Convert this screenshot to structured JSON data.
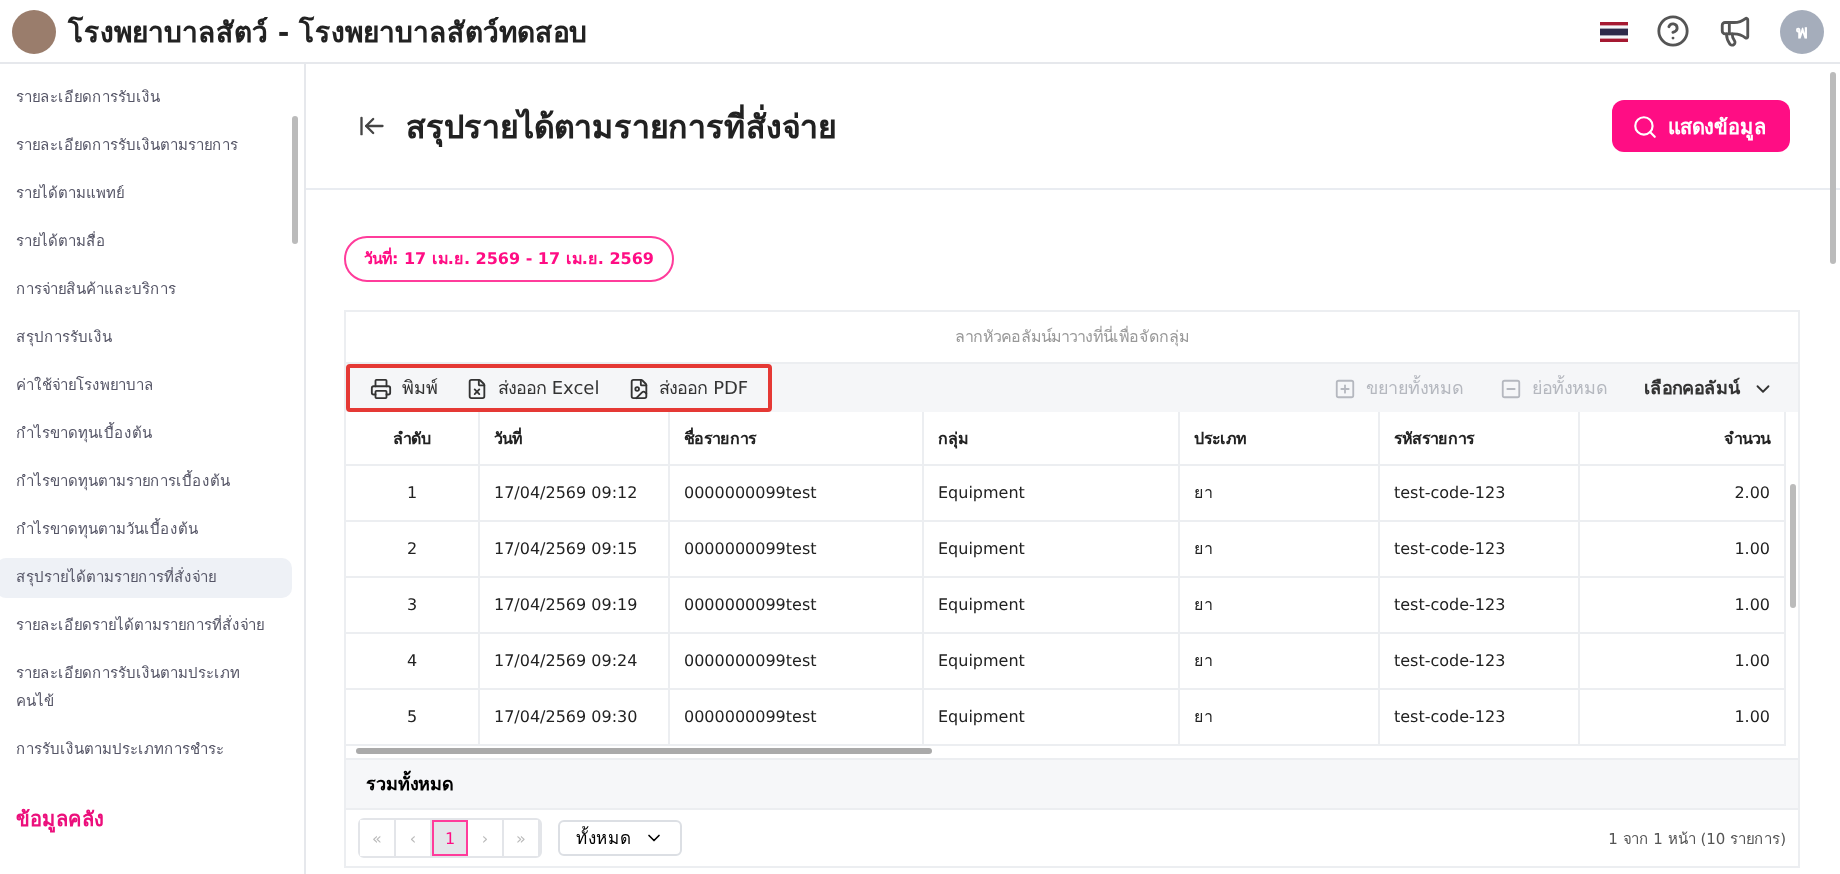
{
  "header": {
    "title": "โรงพยาบาลสัตว์ - โรงพยาบาลสัตว์ทดสอบ",
    "avatar": "พ"
  },
  "sidebar": {
    "items": [
      {
        "label": "รายละเอียดการรับเงิน",
        "selected": false
      },
      {
        "label": "รายละเอียดการรับเงินตามรายการ",
        "selected": false
      },
      {
        "label": "รายได้ตามแพทย์",
        "selected": false
      },
      {
        "label": "รายได้ตามสื่อ",
        "selected": false
      },
      {
        "label": "การจ่ายสินค้าและบริการ",
        "selected": false
      },
      {
        "label": "สรุปการรับเงิน",
        "selected": false
      },
      {
        "label": "ค่าใช้จ่ายโรงพยาบาล",
        "selected": false
      },
      {
        "label": "กำไรขาดทุนเบื้องต้น",
        "selected": false
      },
      {
        "label": "กำไรขาดทุนตามรายการเบื้องต้น",
        "selected": false
      },
      {
        "label": "กำไรขาดทุนตามวันเบื้องต้น",
        "selected": false
      },
      {
        "label": "สรุปรายได้ตามรายการที่สั่งจ่าย",
        "selected": true
      },
      {
        "label": "รายละเอียดรายได้ตามรายการที่สั่งจ่าย",
        "selected": false
      },
      {
        "label": "รายละเอียดการรับเงินตามประเภทคนไข้",
        "selected": false
      },
      {
        "label": "การรับเงินตามประเภทการชำระ",
        "selected": false
      }
    ],
    "section": "ข้อมูลคลัง"
  },
  "page": {
    "title": "สรุปรายได้ตามรายการที่สั่งจ่าย",
    "show_button": "แสดงข้อมูล",
    "date_range": "วันที่: 17 เม.ย. 2569 - 17 เม.ย. 2569"
  },
  "grid": {
    "group_hint": "ลากหัวคอลัมน์มาวางที่นี่เพื่อจัดกลุ่ม",
    "toolbar": [
      {
        "kind": "print",
        "label": "พิมพ์",
        "disabled": false
      },
      {
        "kind": "excel",
        "label": "ส่งออก Excel",
        "disabled": false
      },
      {
        "kind": "pdf",
        "label": "ส่งออก PDF",
        "disabled": false
      }
    ],
    "toolbar_right": [
      {
        "kind": "expand",
        "label": "ขยายทั้งหมด",
        "disabled": true
      },
      {
        "kind": "collapse",
        "label": "ย่อทั้งหมด",
        "disabled": true
      }
    ],
    "column_chooser": "เลือกคอลัมน์",
    "columns": [
      "ลำดับ",
      "วันที่",
      "ชื่อรายการ",
      "กลุ่ม",
      "ประเภท",
      "รหัสรายการ",
      "จำนวน"
    ],
    "rows": [
      [
        "1",
        "17/04/2569 09:12",
        "0000000099test",
        "Equipment",
        "ยา",
        "test-code-123",
        "2.00"
      ],
      [
        "2",
        "17/04/2569 09:15",
        "0000000099test",
        "Equipment",
        "ยา",
        "test-code-123",
        "1.00"
      ],
      [
        "3",
        "17/04/2569 09:19",
        "0000000099test",
        "Equipment",
        "ยา",
        "test-code-123",
        "1.00"
      ],
      [
        "4",
        "17/04/2569 09:24",
        "0000000099test",
        "Equipment",
        "ยา",
        "test-code-123",
        "1.00"
      ],
      [
        "5",
        "17/04/2569 09:30",
        "0000000099test",
        "Equipment",
        "ยา",
        "test-code-123",
        "1.00"
      ]
    ],
    "total_label": "รวมทั้งหมด",
    "pager": {
      "first": "«",
      "prev": "‹",
      "pages": [
        {
          "label": "1",
          "selected": true
        }
      ],
      "next": "›",
      "last": "»",
      "page_size": "ทั้งหมด",
      "summary": "1 จาก 1 หน้า (10 รายการ)"
    }
  }
}
